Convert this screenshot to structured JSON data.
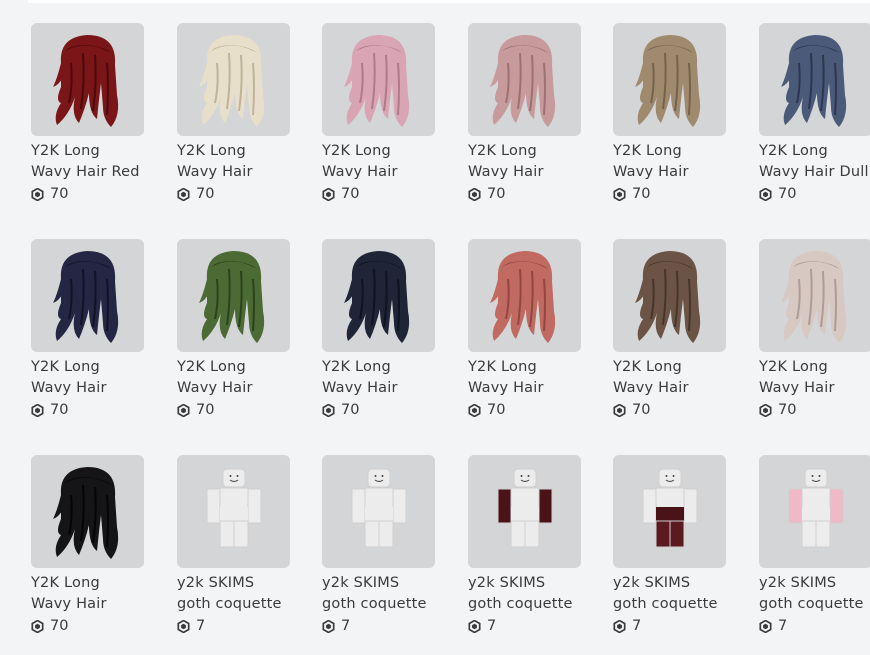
{
  "items": [
    {
      "line1": "Y2K Long",
      "line2": "Wavy Hair Red",
      "price": "70",
      "kind": "hair",
      "color": "#7a1518",
      "shade": "#4a0a0c"
    },
    {
      "line1": "Y2K Long",
      "line2": "Wavy Hair",
      "price": "70",
      "kind": "hair",
      "color": "#e7dfca",
      "shade": "#bfb49a"
    },
    {
      "line1": "Y2K Long",
      "line2": "Wavy Hair",
      "price": "70",
      "kind": "hair",
      "color": "#d9a4b3",
      "shade": "#b07a8a"
    },
    {
      "line1": "Y2K Long",
      "line2": "Wavy Hair",
      "price": "70",
      "kind": "hair",
      "color": "#c79a9c",
      "shade": "#9d7072"
    },
    {
      "line1": "Y2K Long",
      "line2": "Wavy Hair",
      "price": "70",
      "kind": "hair",
      "color": "#a08a6e",
      "shade": "#74624a"
    },
    {
      "line1": "Y2K Long",
      "line2": "Wavy Hair Dull",
      "price": "70",
      "kind": "hair",
      "color": "#4b5a78",
      "shade": "#2c3650"
    },
    {
      "line1": "Y2K Long",
      "line2": "Wavy Hair",
      "price": "70",
      "kind": "hair",
      "color": "#252544",
      "shade": "#121226"
    },
    {
      "line1": "Y2K Long",
      "line2": "Wavy Hair",
      "price": "70",
      "kind": "hair",
      "color": "#4c6a34",
      "shade": "#2d421c"
    },
    {
      "line1": "Y2K Long",
      "line2": "Wavy Hair",
      "price": "70",
      "kind": "hair",
      "color": "#1f2536",
      "shade": "#0f1320"
    },
    {
      "line1": "Y2K Long",
      "line2": "Wavy Hair",
      "price": "70",
      "kind": "hair",
      "color": "#c06a62",
      "shade": "#934640"
    },
    {
      "line1": "Y2K Long",
      "line2": "Wavy Hair",
      "price": "70",
      "kind": "hair",
      "color": "#6b5446",
      "shade": "#45352b"
    },
    {
      "line1": "Y2K Long",
      "line2": "Wavy Hair",
      "price": "70",
      "kind": "hair",
      "color": "#d8c8c2",
      "shade": "#ad9c95"
    },
    {
      "line1": "Y2K Long",
      "line2": "Wavy Hair",
      "price": "70",
      "kind": "hair",
      "color": "#151517",
      "shade": "#050506"
    },
    {
      "line1": "y2k SKIMS",
      "line2": "goth coquette",
      "price": "7",
      "kind": "avatar",
      "color": "#e9e9e9",
      "shade": "#e9e9e9"
    },
    {
      "line1": "y2k SKIMS",
      "line2": "goth coquette",
      "price": "7",
      "kind": "avatar",
      "color": "#f3f3f3",
      "shade": "#e9e9e9"
    },
    {
      "line1": "y2k SKIMS",
      "line2": "goth coquette",
      "price": "7",
      "kind": "avatar",
      "color": "#e9e9e9",
      "shade": "#4a1318"
    },
    {
      "line1": "y2k SKIMS",
      "line2": "goth coquette",
      "price": "7",
      "kind": "avatar",
      "color": "#4a1318",
      "shade": "#e9e9e9"
    },
    {
      "line1": "y2k SKIMS",
      "line2": "goth coquette",
      "price": "7",
      "kind": "avatar",
      "color": "#e9e9e9",
      "shade": "#f0b9c8"
    }
  ]
}
